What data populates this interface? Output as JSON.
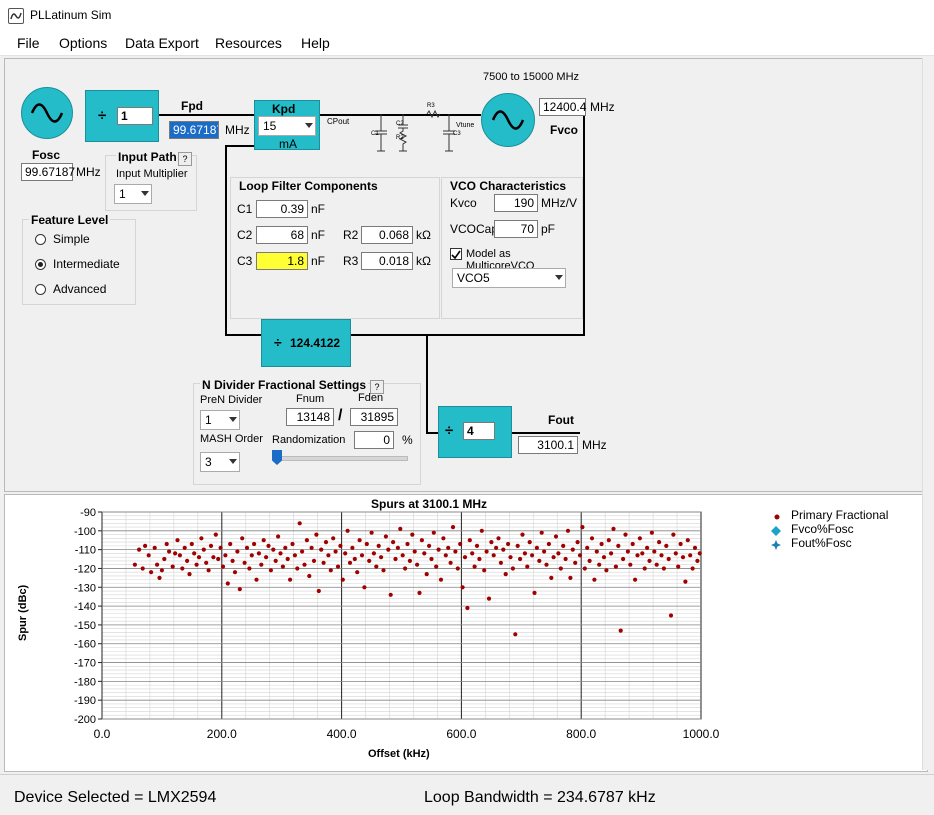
{
  "window": {
    "title": "PLLatinum Sim"
  },
  "menu": [
    "File",
    "Options",
    "Data Export",
    "Resources",
    "Help"
  ],
  "fosc": {
    "label": "Fosc",
    "value": "99.67187",
    "unit": "MHz"
  },
  "ref_divider": {
    "symbol": "÷",
    "value": "1"
  },
  "fpd": {
    "label": "Fpd",
    "value": "99.67187",
    "unit": "MHz"
  },
  "kpd": {
    "label": "Kpd",
    "value": "15",
    "unit": "mA"
  },
  "input_path": {
    "title": "Input Path",
    "help": "?",
    "multiplier_label": "Input Multiplier",
    "multiplier_value": "1"
  },
  "feature_level": {
    "title": "Feature Level",
    "options": [
      "Simple",
      "Intermediate",
      "Advanced"
    ],
    "selected": "Intermediate"
  },
  "schematic": {
    "cpout": "CPout",
    "vtune": "Vtune",
    "c1": "C1",
    "c2": "C2",
    "c3": "C3",
    "r2": "R2",
    "r3": "R3"
  },
  "vco": {
    "range": "7500 to 15000 MHz",
    "fvco_label": "Fvco",
    "fvco_value": "12400.4",
    "unit": "MHz"
  },
  "loop_filter": {
    "title": "Loop Filter Components",
    "c1": {
      "label": "C1",
      "value": "0.39",
      "unit": "nF"
    },
    "c2": {
      "label": "C2",
      "value": "68",
      "unit": "nF"
    },
    "c3": {
      "label": "C3",
      "value": "1.8",
      "unit": "nF"
    },
    "r2": {
      "label": "R2",
      "value": "0.068",
      "unit": "kΩ"
    },
    "r3": {
      "label": "R3",
      "value": "0.018",
      "unit": "kΩ"
    }
  },
  "vco_char": {
    "title": "VCO Characteristics",
    "kvco_label": "Kvco",
    "kvco_value": "190",
    "kvco_unit": "MHz/V",
    "vcocap_label": "VCOCap",
    "vcocap_value": "70",
    "vcocap_unit": "pF",
    "multicore_label": "Model as MulticoreVCO",
    "multicore_checked": true,
    "vco_select": "VCO5"
  },
  "n_divider": {
    "symbol": "÷",
    "value": "124.4122"
  },
  "n_frac": {
    "title": "N Divider Fractional Settings",
    "help": "?",
    "pren_label": "PreN Divider",
    "pren_value": "1",
    "fnum_label": "Fnum",
    "fnum_value": "13148",
    "fden_label": "Fden",
    "fden_value": "31895",
    "slash": "/",
    "mash_label": "MASH Order",
    "mash_value": "3",
    "random_label": "Randomization",
    "random_value": "0",
    "random_unit": "%"
  },
  "out_divider": {
    "symbol": "÷",
    "value": "4"
  },
  "fout": {
    "label": "Fout",
    "value": "3100.1",
    "unit": "MHz"
  },
  "status": {
    "device": "Device Selected = LMX2594",
    "bandwidth": "Loop Bandwidth = 234.6787 kHz"
  },
  "chart_data": {
    "type": "scatter",
    "title": "Spurs at 3100.1 MHz",
    "xlabel": "Offset (kHz)",
    "ylabel": "Spur (dBc)",
    "xlim": [
      0,
      1000
    ],
    "ylim": [
      -200,
      -90
    ],
    "x_ticks": [
      "0.0",
      "200.0",
      "400.0",
      "600.0",
      "800.0",
      "1000.0"
    ],
    "y_ticks": [
      "-90",
      "-100",
      "-110",
      "-120",
      "-130",
      "-140",
      "-150",
      "-160",
      "-170",
      "-180",
      "-190",
      "-200"
    ],
    "grid": true,
    "legend_position": "top-right",
    "colors": {
      "primary": "#a00000",
      "fvco": "#1aa3c9",
      "fout": "#1f7fb3"
    },
    "legend": [
      "Primary Fractional",
      "Fvco%Fosc",
      "Fout%Fosc"
    ],
    "series": [
      {
        "name": "Primary Fractional",
        "points": [
          [
            55,
            -118
          ],
          [
            62,
            -110
          ],
          [
            68,
            -120
          ],
          [
            72,
            -108
          ],
          [
            78,
            -113
          ],
          [
            82,
            -122
          ],
          [
            88,
            -109
          ],
          [
            92,
            -118
          ],
          [
            96,
            -125
          ],
          [
            100,
            -121
          ],
          [
            104,
            -115
          ],
          [
            108,
            -107
          ],
          [
            112,
            -111
          ],
          [
            118,
            -119
          ],
          [
            122,
            -112
          ],
          [
            126,
            -105
          ],
          [
            130,
            -113
          ],
          [
            134,
            -120
          ],
          [
            138,
            -109
          ],
          [
            142,
            -116
          ],
          [
            146,
            -123
          ],
          [
            150,
            -107
          ],
          [
            154,
            -112
          ],
          [
            158,
            -118
          ],
          [
            162,
            -114
          ],
          [
            166,
            -104
          ],
          [
            170,
            -110
          ],
          [
            174,
            -117
          ],
          [
            178,
            -121
          ],
          [
            182,
            -108
          ],
          [
            186,
            -114
          ],
          [
            190,
            -102
          ],
          [
            194,
            -115
          ],
          [
            198,
            -109
          ],
          [
            202,
            -119
          ],
          [
            206,
            -113
          ],
          [
            210,
            -128
          ],
          [
            214,
            -107
          ],
          [
            218,
            -116
          ],
          [
            222,
            -122
          ],
          [
            226,
            -111
          ],
          [
            230,
            -131
          ],
          [
            234,
            -104
          ],
          [
            238,
            -117
          ],
          [
            242,
            -109
          ],
          [
            246,
            -120
          ],
          [
            250,
            -113
          ],
          [
            254,
            -107
          ],
          [
            258,
            -126
          ],
          [
            262,
            -112
          ],
          [
            266,
            -118
          ],
          [
            270,
            -105
          ],
          [
            274,
            -114
          ],
          [
            278,
            -108
          ],
          [
            282,
            -121
          ],
          [
            286,
            -110
          ],
          [
            290,
            -116
          ],
          [
            294,
            -103
          ],
          [
            298,
            -112
          ],
          [
            302,
            -119
          ],
          [
            306,
            -109
          ],
          [
            310,
            -115
          ],
          [
            314,
            -126
          ],
          [
            318,
            -107
          ],
          [
            322,
            -113
          ],
          [
            326,
            -120
          ],
          [
            330,
            -96
          ],
          [
            334,
            -111
          ],
          [
            338,
            -118
          ],
          [
            342,
            -105
          ],
          [
            346,
            -124
          ],
          [
            350,
            -109
          ],
          [
            354,
            -116
          ],
          [
            358,
            -102
          ],
          [
            362,
            -132
          ],
          [
            366,
            -110
          ],
          [
            370,
            -117
          ],
          [
            374,
            -106
          ],
          [
            378,
            -113
          ],
          [
            382,
            -121
          ],
          [
            386,
            -104
          ],
          [
            390,
            -111
          ],
          [
            394,
            -119
          ],
          [
            398,
            -108
          ],
          [
            402,
            -126
          ],
          [
            406,
            -112
          ],
          [
            410,
            -100
          ],
          [
            414,
            -117
          ],
          [
            418,
            -109
          ],
          [
            422,
            -115
          ],
          [
            426,
            -122
          ],
          [
            430,
            -105
          ],
          [
            434,
            -113
          ],
          [
            438,
            -130
          ],
          [
            442,
            -107
          ],
          [
            446,
            -116
          ],
          [
            450,
            -101
          ],
          [
            454,
            -112
          ],
          [
            458,
            -119
          ],
          [
            462,
            -108
          ],
          [
            466,
            -114
          ],
          [
            470,
            -121
          ],
          [
            474,
            -103
          ],
          [
            478,
            -110
          ],
          [
            482,
            -134
          ],
          [
            486,
            -106
          ],
          [
            490,
            -115
          ],
          [
            494,
            -109
          ],
          [
            498,
            -99
          ],
          [
            502,
            -113
          ],
          [
            506,
            -120
          ],
          [
            510,
            -107
          ],
          [
            514,
            -116
          ],
          [
            518,
            -102
          ],
          [
            522,
            -111
          ],
          [
            526,
            -118
          ],
          [
            530,
            -133
          ],
          [
            534,
            -105
          ],
          [
            538,
            -112
          ],
          [
            542,
            -123
          ],
          [
            546,
            -108
          ],
          [
            550,
            -115
          ],
          [
            554,
            -101
          ],
          [
            558,
            -119
          ],
          [
            562,
            -110
          ],
          [
            566,
            -126
          ],
          [
            570,
            -104
          ],
          [
            574,
            -113
          ],
          [
            578,
            -109
          ],
          [
            582,
            -117
          ],
          [
            586,
            -98
          ],
          [
            590,
            -111
          ],
          [
            594,
            -120
          ],
          [
            598,
            -107
          ],
          [
            602,
            -130
          ],
          [
            606,
            -114
          ],
          [
            610,
            -141
          ],
          [
            614,
            -105
          ],
          [
            618,
            -112
          ],
          [
            622,
            -119
          ],
          [
            626,
            -108
          ],
          [
            630,
            -115
          ],
          [
            634,
            -100
          ],
          [
            638,
            -121
          ],
          [
            642,
            -111
          ],
          [
            646,
            -136
          ],
          [
            650,
            -106
          ],
          [
            654,
            -113
          ],
          [
            658,
            -109
          ],
          [
            662,
            -104
          ],
          [
            666,
            -117
          ],
          [
            670,
            -110
          ],
          [
            674,
            -123
          ],
          [
            678,
            -107
          ],
          [
            682,
            -114
          ],
          [
            686,
            -120
          ],
          [
            690,
            -155
          ],
          [
            694,
            -108
          ],
          [
            698,
            -115
          ],
          [
            702,
            -102
          ],
          [
            706,
            -112
          ],
          [
            710,
            -119
          ],
          [
            714,
            -106
          ],
          [
            718,
            -113
          ],
          [
            722,
            -133
          ],
          [
            726,
            -109
          ],
          [
            730,
            -116
          ],
          [
            734,
            -101
          ],
          [
            738,
            -111
          ],
          [
            742,
            -118
          ],
          [
            746,
            -107
          ],
          [
            750,
            -125
          ],
          [
            754,
            -114
          ],
          [
            758,
            -103
          ],
          [
            762,
            -112
          ],
          [
            766,
            -120
          ],
          [
            770,
            -108
          ],
          [
            774,
            -115
          ],
          [
            778,
            -100
          ],
          [
            782,
            -125
          ],
          [
            786,
            -110
          ],
          [
            790,
            -117
          ],
          [
            794,
            -106
          ],
          [
            798,
            -113
          ],
          [
            802,
            -98
          ],
          [
            806,
            -120
          ],
          [
            810,
            -109
          ],
          [
            814,
            -116
          ],
          [
            818,
            -104
          ],
          [
            822,
            -126
          ],
          [
            826,
            -111
          ],
          [
            830,
            -118
          ],
          [
            834,
            -107
          ],
          [
            838,
            -114
          ],
          [
            842,
            -121
          ],
          [
            846,
            -105
          ],
          [
            850,
            -112
          ],
          [
            854,
            -99
          ],
          [
            858,
            -119
          ],
          [
            862,
            -108
          ],
          [
            866,
            -153
          ],
          [
            870,
            -115
          ],
          [
            874,
            -102
          ],
          [
            878,
            -111
          ],
          [
            882,
            -118
          ],
          [
            886,
            -107
          ],
          [
            890,
            -126
          ],
          [
            894,
            -113
          ],
          [
            898,
            -104
          ],
          [
            902,
            -112
          ],
          [
            906,
            -120
          ],
          [
            910,
            -109
          ],
          [
            914,
            -116
          ],
          [
            918,
            -101
          ],
          [
            922,
            -111
          ],
          [
            926,
            -118
          ],
          [
            930,
            -106
          ],
          [
            934,
            -113
          ],
          [
            938,
            -120
          ],
          [
            942,
            -108
          ],
          [
            946,
            -115
          ],
          [
            950,
            -145
          ],
          [
            954,
            -102
          ],
          [
            958,
            -112
          ],
          [
            962,
            -119
          ],
          [
            966,
            -107
          ],
          [
            970,
            -114
          ],
          [
            974,
            -127
          ],
          [
            978,
            -105
          ],
          [
            982,
            -113
          ],
          [
            986,
            -120
          ],
          [
            990,
            -109
          ],
          [
            994,
            -116
          ],
          [
            998,
            -112
          ]
        ]
      },
      {
        "name": "Fvco%Fosc",
        "points": []
      },
      {
        "name": "Fout%Fosc",
        "points": []
      }
    ]
  }
}
